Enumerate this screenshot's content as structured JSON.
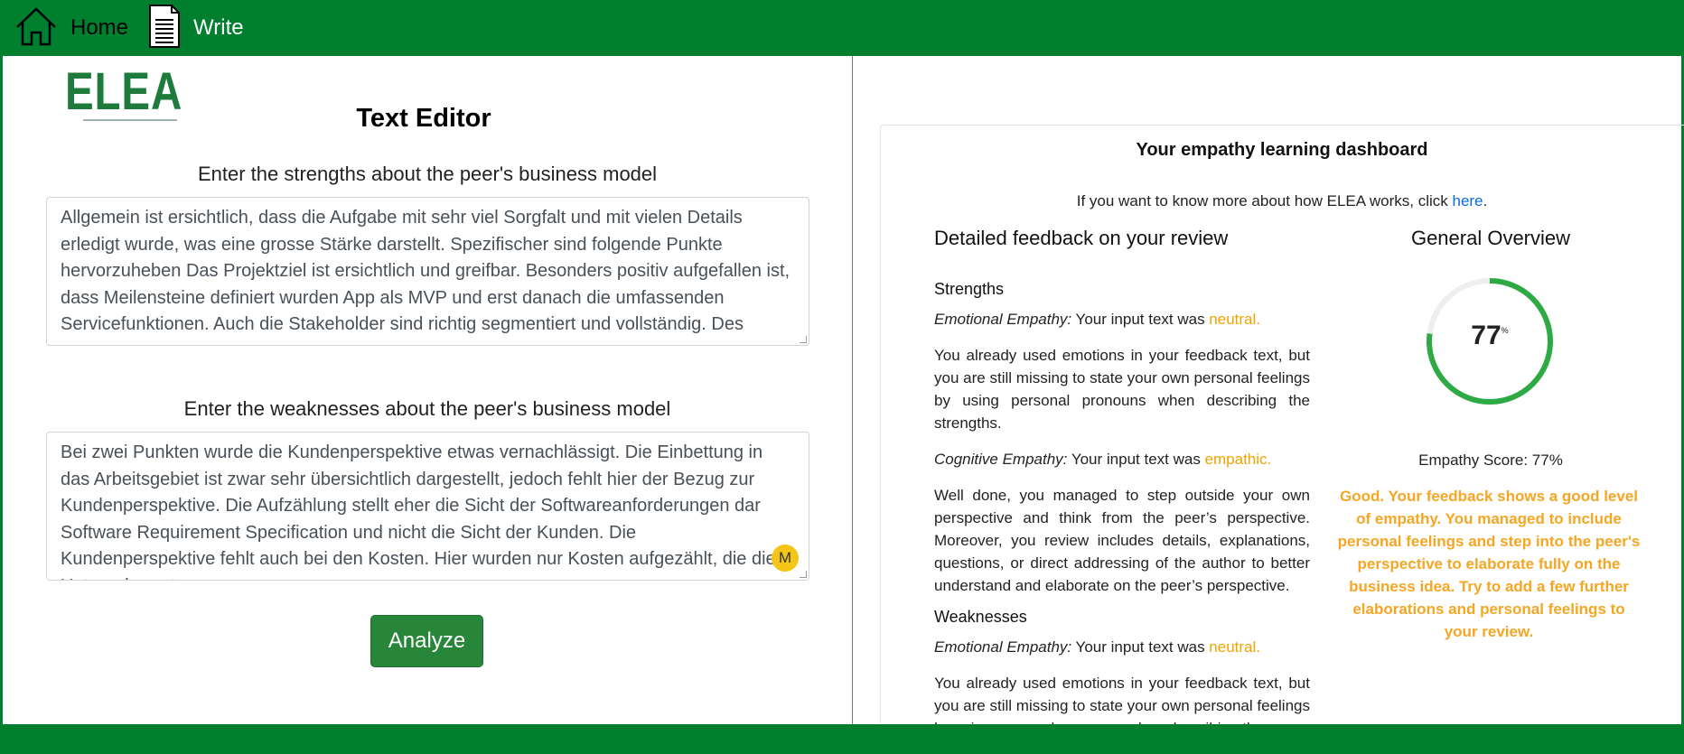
{
  "nav": {
    "home_label": "Home",
    "write_label": "Write",
    "home_icon": "home-icon",
    "write_icon": "document-icon"
  },
  "logo": {
    "text": "ELEA"
  },
  "editor": {
    "title": "Text Editor",
    "strengths_label": "Enter the strengths about the peer's business model",
    "strengths_text": "Allgemein ist ersichtlich, dass die Aufgabe mit sehr viel Sorgfalt und mit vielen Details erledigt wurde, was eine grosse Stärke darstellt. Spezifischer sind folgende Punkte hervorzuheben Das Projektziel ist ersichtlich und greifbar. Besonders positiv aufgefallen ist, dass Meilensteine definiert wurden App als MVP und erst danach die umfassenden Servicefunktionen. Auch die Stakeholder sind richtig segmentiert und vollständig. Des",
    "weaknesses_label": "Enter the weaknesses about the peer's business model",
    "weaknesses_text": "Bei zwei Punkten wurde die Kundenperspektive etwas vernachlässigt. Die Einbettung in das Arbeitsgebiet ist zwar sehr übersichtlich dargestellt, jedoch fehlt hier der Bezug zur Kundenperspektive. Die Aufzählung stellt eher die Sicht der Softwareanforderungen dar Software Requirement Specification und nicht die Sicht der Kunden. Die Kundenperspektive fehlt auch bei den Kosten. Hier wurden nur Kosten aufgezählt, die die Unternehmer tragen",
    "cursor_badge": "M",
    "analyze_label": "Analyze"
  },
  "dashboard": {
    "title": "Your empathy learning dashboard",
    "info_prefix": "If you want to know more about how ELEA works, click ",
    "info_link": "here",
    "info_suffix": ".",
    "feedback_heading": "Detailed feedback on your review",
    "overview_heading": "General Overview",
    "strengths": {
      "heading": "Strengths",
      "emotional_label": "Emotional Empathy:",
      "emotional_text": " Your input text was ",
      "emotional_value": "neutral.",
      "emotional_feedback": "You already used emotions in your feedback text, but you are still missing to state your own personal feelings by using personal pronouns when describing the strengths.",
      "cognitive_label": "Cognitive Empathy:",
      "cognitive_text": " Your input text was ",
      "cognitive_value": "empathic.",
      "cognitive_feedback": "Well done, you managed to step outside your own perspective and think from the peer’s perspective. Moreover, you review includes details, explanations, questions, or direct addressing of the author to better understand and elaborate on the peer’s perspective."
    },
    "weaknesses": {
      "heading": "Weaknesses",
      "emotional_label": "Emotional Empathy:",
      "emotional_text": " Your input text was ",
      "emotional_value": "neutral.",
      "emotional_feedback": "You already used emotions in your feedback text, but you are still missing to state your own personal feelings by using personal pronouns when describing the"
    },
    "gauge_value": "77",
    "gauge_unit": "%",
    "gauge_fraction": 0.77,
    "empathy_score": "Empathy Score: 77%",
    "overview_message": "Good. Your feedback shows a good level of empathy. You managed to include personal feelings and step into the peer's perspective to elaborate fully on the business idea. Try to add a few further elaborations and personal feelings to your review."
  },
  "colors": {
    "brand_green": "#007f2e",
    "button_green": "#28863a",
    "gauge_green": "#2eaa44",
    "highlight_orange": "#f0a400",
    "link_blue": "#0a6ae0"
  }
}
